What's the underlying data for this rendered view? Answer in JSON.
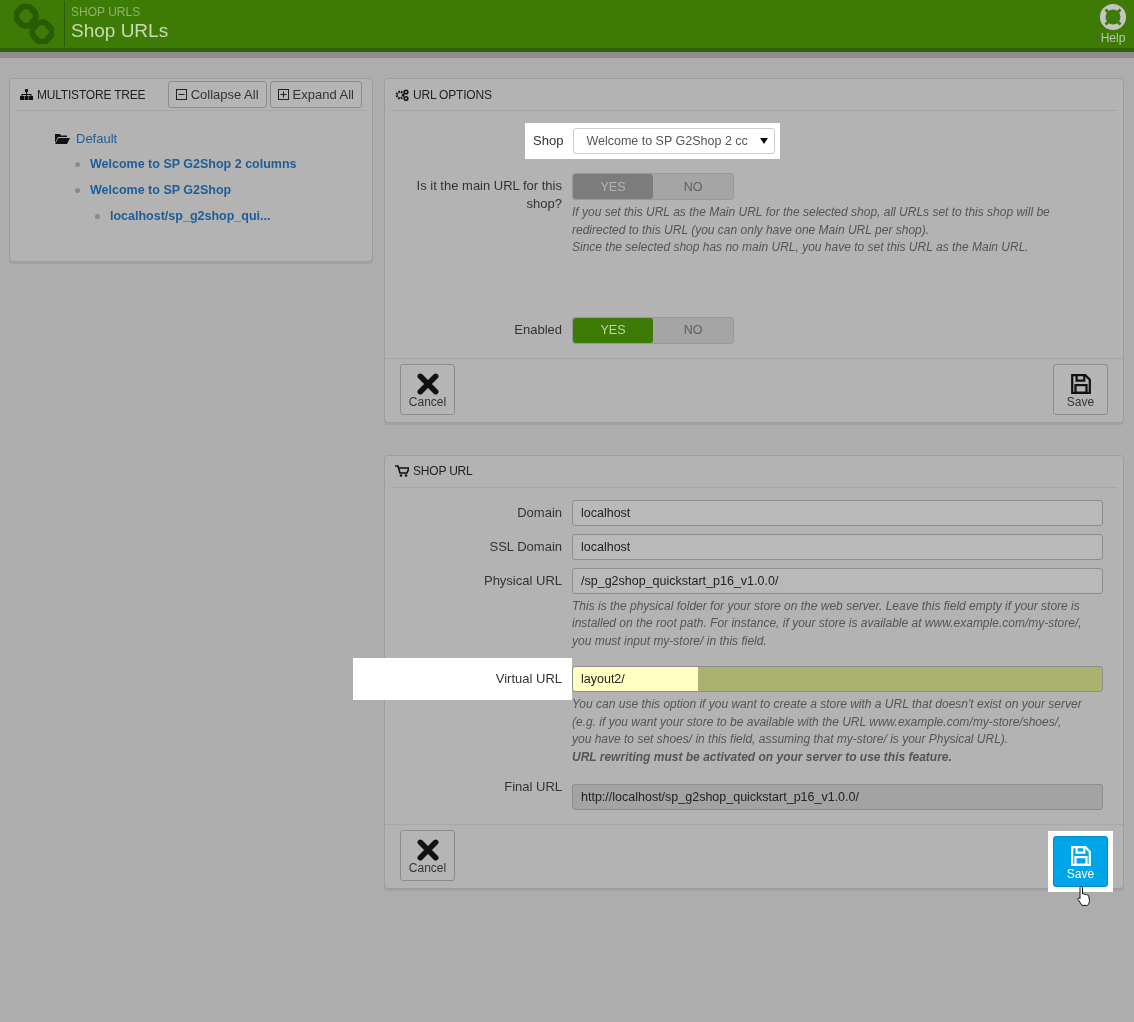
{
  "header": {
    "breadcrumb": "SHOP URLS",
    "title": "Shop URLs",
    "help": "Help"
  },
  "tree_panel": {
    "title": "MULTISTORE TREE",
    "buttons": [
      {
        "kind": "collapse",
        "label": "Collapse All"
      },
      {
        "kind": "expand",
        "label": "Expand All"
      }
    ],
    "tree": [
      {
        "label": "Default",
        "children": [
          {
            "label": "Welcome to SP G2Shop 2 columns"
          },
          {
            "label": "Welcome to SP G2Shop",
            "children": [
              {
                "label": "localhost/sp_g2shop_qui..."
              }
            ]
          }
        ]
      }
    ]
  },
  "url_options": {
    "title": "URL OPTIONS",
    "fields": [
      {
        "kind": "select",
        "label": "Shop",
        "value": "Welcome to SP G2Shop 2 cc",
        "highlighted": true
      },
      {
        "kind": "switch",
        "label": "Is it the main URL for this shop?",
        "disabled": true,
        "options": [
          {
            "label": "YES",
            "selected": true
          },
          {
            "label": "NO",
            "selected": false
          }
        ],
        "help": [
          "If you set this URL as the Main URL for the selected shop, all URLs set to this shop will be redirected to this URL (you can only have one Main URL per shop).",
          "Since the selected shop has no main URL, you have to set this URL as the Main URL."
        ]
      },
      {
        "kind": "switch",
        "label": "Enabled",
        "disabled": false,
        "options": [
          {
            "label": "YES",
            "selected": true
          },
          {
            "label": "NO",
            "selected": false
          }
        ]
      }
    ],
    "cancel": {
      "label": "Cancel"
    },
    "save": {
      "label": "Save",
      "highlighted": false
    }
  },
  "shop_url": {
    "title": "SHOP URL",
    "fields": [
      {
        "kind": "text",
        "label": "Domain",
        "value": "localhost"
      },
      {
        "kind": "text",
        "label": "SSL Domain",
        "value": "localhost"
      },
      {
        "kind": "text",
        "label": "Physical URL",
        "value": "/sp_g2shop_quickstart_p16_v1.0.0/",
        "help": [
          "This is the physical folder for your store on the web server. Leave this field empty if your store is installed on the root path. For instance, if your store is available at www.example.com/my-store/, you must input my-store/ in this field."
        ]
      },
      {
        "kind": "text",
        "label": "Virtual URL",
        "value": "layout2/",
        "highlighted": true,
        "help": [
          "You can use this option if you want to create a store with a URL that doesn't exist on your server (e.g. if you want your store to be available with the URL www.example.com/my-store/shoes/, you have to set shoes/ in this field, assuming that my-store/ is your Physical URL).",
          "**URL rewriting must be activated on your server to use this feature.**"
        ]
      },
      {
        "kind": "readonly",
        "label": "Final URL",
        "value": "http://localhost/sp_g2shop_quickstart_p16_v1.0.0/"
      }
    ],
    "cancel": {
      "label": "Cancel"
    },
    "save": {
      "label": "Save",
      "highlighted": true
    }
  }
}
